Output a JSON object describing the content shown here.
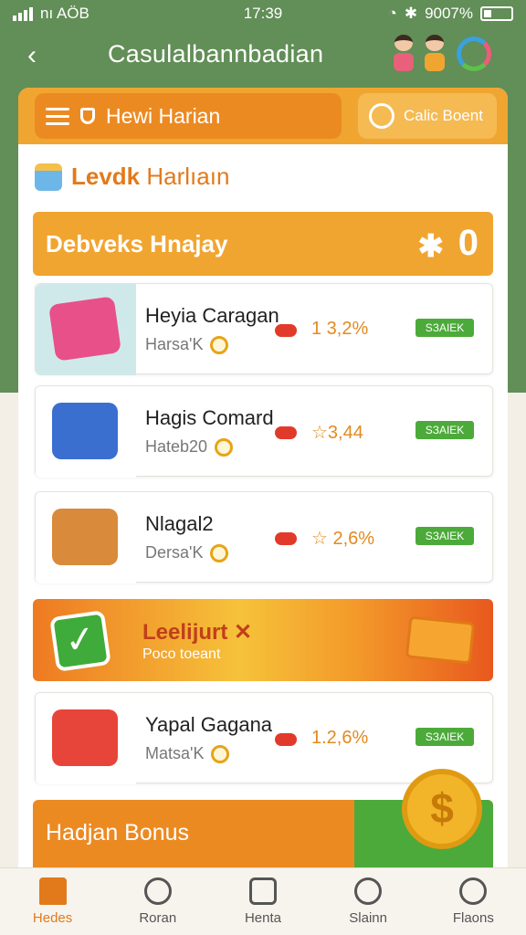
{
  "status_bar": {
    "carrier": "nı AÖB",
    "time": "17:39",
    "battery": "9007%"
  },
  "header": {
    "title": "Casulalbannbadian"
  },
  "toolbar": {
    "menu_label": "Hewi Harian",
    "coin_label": "Calic Boent"
  },
  "section": {
    "title_bold": "Levdk",
    "title_rest": "Harlıaın"
  },
  "banner": {
    "title": "Debveks Hnajay",
    "count": "0"
  },
  "items": [
    {
      "name": "Heyia Caragan",
      "sub": "Harsa'K",
      "value": "1 3,2%",
      "badge": "SЗAIEK"
    },
    {
      "name": "Hagis Comard",
      "sub": "Hateb20",
      "value": "☆3,44",
      "badge": "SЗAIEK"
    },
    {
      "name": "Nlagal2",
      "sub": "Dersa'K",
      "value": "☆ 2,6%",
      "badge": "SЗAIEK"
    },
    {
      "name": "Yapal Gagana",
      "sub": "Matsa'K",
      "value": "1.2,6%",
      "badge": "SЗAIEK"
    }
  ],
  "promo": {
    "title": "Leelijurt ✕",
    "subtitle": "Poco toeant"
  },
  "bonus": {
    "title": "Hadjan Bonus"
  },
  "nav": [
    {
      "label": "Hedes",
      "icon": "home-icon"
    },
    {
      "label": "Roran",
      "icon": "profile-icon"
    },
    {
      "label": "Henta",
      "icon": "document-icon"
    },
    {
      "label": "Slainn",
      "icon": "search-icon"
    },
    {
      "label": "Flaons",
      "icon": "account-icon"
    }
  ],
  "colors": {
    "accent_orange": "#f0a531",
    "deep_orange": "#ec8a22",
    "green": "#4caa3a",
    "header_green": "#628e57"
  }
}
